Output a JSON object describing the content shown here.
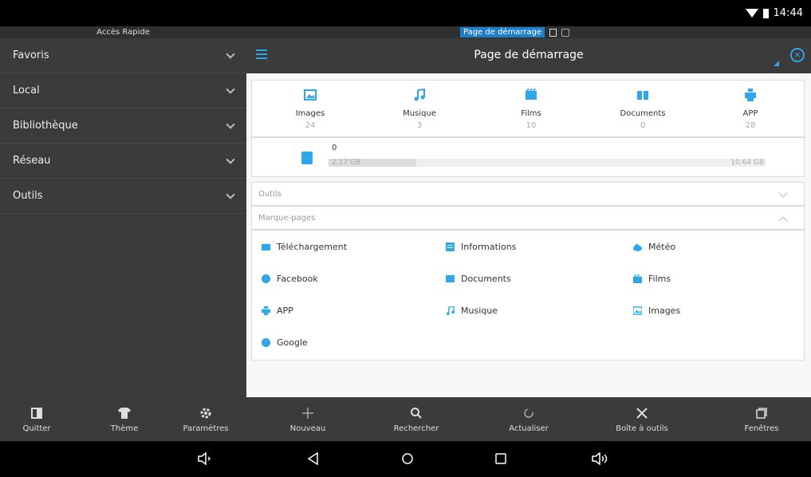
{
  "status": {
    "time": "14:44"
  },
  "sidebar": {
    "header": "Accès Rapide",
    "items": [
      {
        "label": "Favoris"
      },
      {
        "label": "Local"
      },
      {
        "label": "Bibliothèque"
      },
      {
        "label": "Réseau"
      },
      {
        "label": "Outils"
      }
    ]
  },
  "topstrip": {
    "active_tab": "Page de démarrage"
  },
  "header": {
    "title": "Page de démarrage"
  },
  "categories": [
    {
      "label": "Images",
      "count": "24",
      "icon": "image-icon"
    },
    {
      "label": "Musique",
      "count": "3",
      "icon": "music-icon"
    },
    {
      "label": "Films",
      "count": "10",
      "icon": "film-icon"
    },
    {
      "label": "Documents",
      "count": "0",
      "icon": "book-icon"
    },
    {
      "label": "APP",
      "count": "28",
      "icon": "app-icon"
    }
  ],
  "storage": {
    "name": "0",
    "used": "2,17 GB",
    "total": "10,64 GB",
    "fill": 0.2
  },
  "sections": {
    "outils": "Outils",
    "marque_pages": "Marque-pages"
  },
  "bookmarks": [
    {
      "label": "Téléchargement",
      "icon": "download-folder-icon"
    },
    {
      "label": "Informations",
      "icon": "news-icon"
    },
    {
      "label": "Météo",
      "icon": "weather-icon"
    },
    {
      "label": "Facebook",
      "icon": "globe-icon"
    },
    {
      "label": "Documents",
      "icon": "documents-icon"
    },
    {
      "label": "Films",
      "icon": "film-icon"
    },
    {
      "label": "APP",
      "icon": "app-icon"
    },
    {
      "label": "Musique",
      "icon": "music-icon"
    },
    {
      "label": "Images",
      "icon": "image-icon"
    },
    {
      "label": "Google",
      "icon": "globe-icon"
    }
  ],
  "toolbar": [
    {
      "label": "Quitter"
    },
    {
      "label": "Thème"
    },
    {
      "label": "Paramètres"
    },
    {
      "label": "Nouveau"
    },
    {
      "label": "Rechercher"
    },
    {
      "label": "Actualiser"
    },
    {
      "label": "Boîte à outils"
    },
    {
      "label": "Fenêtres"
    }
  ],
  "colors": {
    "accent": "#2ea6e8",
    "panel": "#3b3b3b"
  }
}
